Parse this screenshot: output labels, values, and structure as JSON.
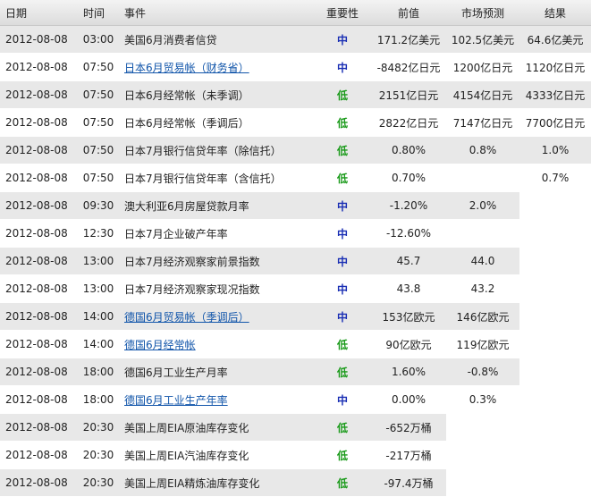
{
  "headers": {
    "date": "日期",
    "time": "时间",
    "event": "事件",
    "importance": "重要性",
    "previous": "前值",
    "forecast": "市场预测",
    "result": "结果"
  },
  "colors": {
    "importance_high": "#1a2fb4",
    "importance_low": "#1a9a1a",
    "link": "#1155aa",
    "row_shade": "#e8e8e8"
  },
  "rows": [
    {
      "date": "2012-08-08",
      "time": "03:00",
      "event": "美国6月消费者信贷",
      "link": false,
      "importance": "中",
      "level": "high",
      "previous": "171.2亿美元",
      "forecast": "102.5亿美元",
      "result": "64.6亿美元"
    },
    {
      "date": "2012-08-08",
      "time": "07:50",
      "event": "日本6月贸易帐（财务省）",
      "link": true,
      "importance": "中",
      "level": "high",
      "previous": "-8482亿日元",
      "forecast": "1200亿日元",
      "result": "1120亿日元"
    },
    {
      "date": "2012-08-08",
      "time": "07:50",
      "event": "日本6月经常帐（未季调）",
      "link": false,
      "importance": "低",
      "level": "low",
      "previous": "2151亿日元",
      "forecast": "4154亿日元",
      "result": "4333亿日元"
    },
    {
      "date": "2012-08-08",
      "time": "07:50",
      "event": "日本6月经常帐（季调后）",
      "link": false,
      "importance": "低",
      "level": "low",
      "previous": "2822亿日元",
      "forecast": "7147亿日元",
      "result": "7700亿日元"
    },
    {
      "date": "2012-08-08",
      "time": "07:50",
      "event": "日本7月银行信贷年率（除信托）",
      "link": false,
      "importance": "低",
      "level": "low",
      "previous": "0.80%",
      "forecast": "0.8%",
      "result": "1.0%"
    },
    {
      "date": "2012-08-08",
      "time": "07:50",
      "event": "日本7月银行信贷年率（含信托）",
      "link": false,
      "importance": "低",
      "level": "low",
      "previous": "0.70%",
      "forecast": "",
      "result": "0.7%"
    },
    {
      "date": "2012-08-08",
      "time": "09:30",
      "event": "澳大利亚6月房屋贷款月率",
      "link": false,
      "importance": "中",
      "level": "high",
      "previous": "-1.20%",
      "forecast": "2.0%",
      "result": ""
    },
    {
      "date": "2012-08-08",
      "time": "12:30",
      "event": "日本7月企业破产年率",
      "link": false,
      "importance": "中",
      "level": "high",
      "previous": "-12.60%",
      "forecast": "",
      "result": ""
    },
    {
      "date": "2012-08-08",
      "time": "13:00",
      "event": "日本7月经济观察家前景指数",
      "link": false,
      "importance": "中",
      "level": "high",
      "previous": "45.7",
      "forecast": "44.0",
      "result": ""
    },
    {
      "date": "2012-08-08",
      "time": "13:00",
      "event": "日本7月经济观察家现况指数",
      "link": false,
      "importance": "中",
      "level": "high",
      "previous": "43.8",
      "forecast": "43.2",
      "result": ""
    },
    {
      "date": "2012-08-08",
      "time": "14:00",
      "event": "德国6月贸易帐（季调后）",
      "link": true,
      "importance": "中",
      "level": "high",
      "previous": "153亿欧元",
      "forecast": "146亿欧元",
      "result": ""
    },
    {
      "date": "2012-08-08",
      "time": "14:00",
      "event": "德国6月经常帐",
      "link": true,
      "importance": "低",
      "level": "low",
      "previous": "90亿欧元",
      "forecast": "119亿欧元",
      "result": ""
    },
    {
      "date": "2012-08-08",
      "time": "18:00",
      "event": "德国6月工业生产月率",
      "link": false,
      "importance": "低",
      "level": "low",
      "previous": "1.60%",
      "forecast": "-0.8%",
      "result": ""
    },
    {
      "date": "2012-08-08",
      "time": "18:00",
      "event": "德国6月工业生产年率",
      "link": true,
      "importance": "中",
      "level": "high",
      "previous": "0.00%",
      "forecast": "0.3%",
      "result": ""
    },
    {
      "date": "2012-08-08",
      "time": "20:30",
      "event": "美国上周EIA原油库存变化",
      "link": false,
      "importance": "低",
      "level": "low",
      "previous": "-652万桶",
      "forecast": "",
      "result": ""
    },
    {
      "date": "2012-08-08",
      "time": "20:30",
      "event": "美国上周EIA汽油库存变化",
      "link": false,
      "importance": "低",
      "level": "low",
      "previous": "-217万桶",
      "forecast": "",
      "result": ""
    },
    {
      "date": "2012-08-08",
      "time": "20:30",
      "event": "美国上周EIA精炼油库存变化",
      "link": false,
      "importance": "低",
      "level": "low",
      "previous": "-97.4万桶",
      "forecast": "",
      "result": ""
    }
  ]
}
